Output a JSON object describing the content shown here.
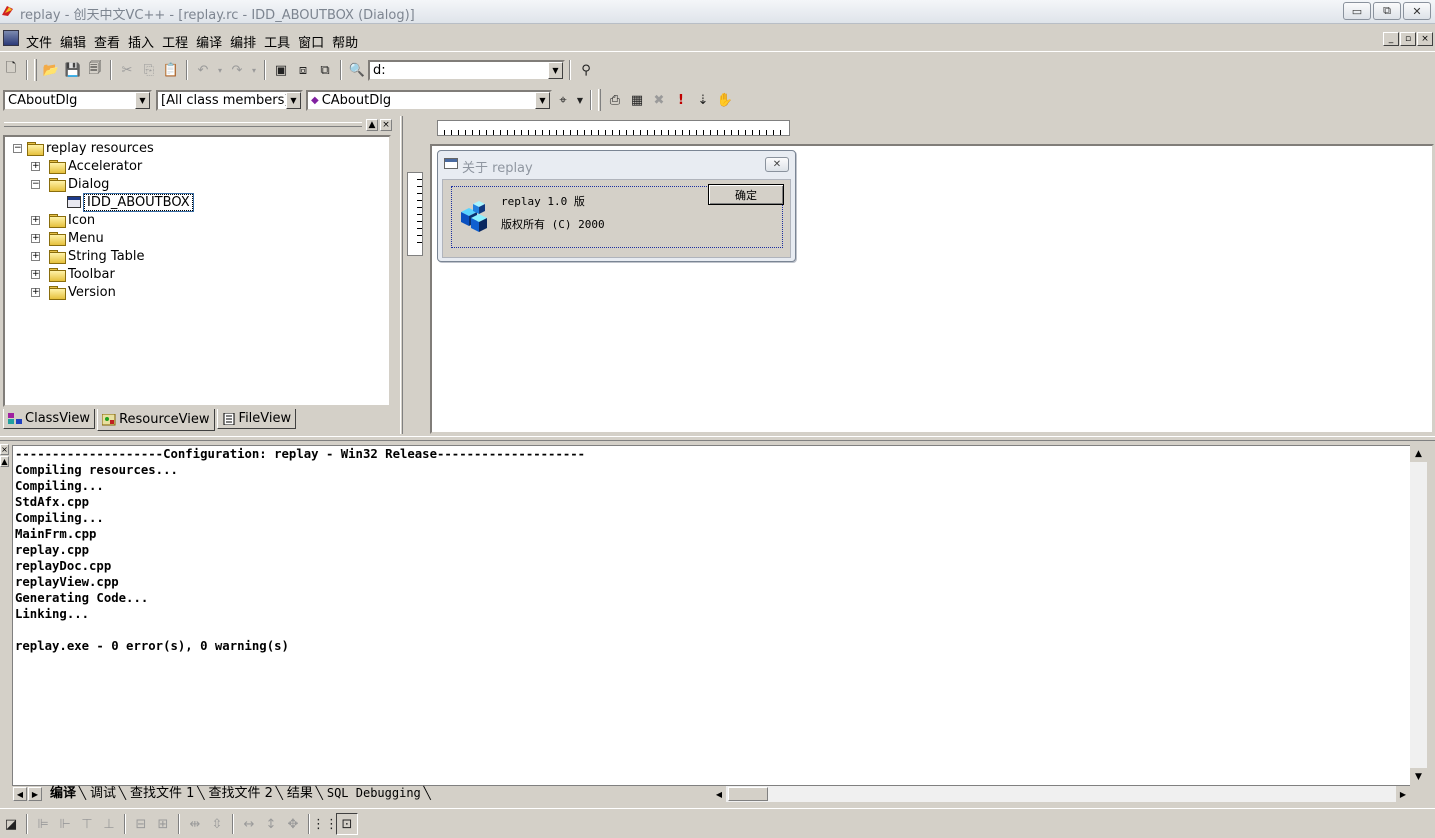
{
  "window": {
    "title": "replay - 创天中文VC++ - [replay.rc - IDD_ABOUTBOX (Dialog)]",
    "buttons": {
      "minimize": "▭",
      "restore": "⧉",
      "close": "✕"
    }
  },
  "menu": {
    "items": [
      "文件",
      "编辑",
      "查看",
      "插入",
      "工程",
      "编译",
      "编排",
      "工具",
      "窗口",
      "帮助"
    ]
  },
  "toolbar": {
    "find_combo_value": "d:",
    "class_combo": "CAboutDlg",
    "filter_combo": "[All class members]",
    "member_combo": "CAboutDlg"
  },
  "workspace": {
    "tree": {
      "root": "replay resources",
      "nodes": [
        {
          "label": "Accelerator"
        },
        {
          "label": "Dialog"
        },
        {
          "label": "IDD_ABOUTBOX"
        },
        {
          "label": "Icon"
        },
        {
          "label": "Menu"
        },
        {
          "label": "String Table"
        },
        {
          "label": "Toolbar"
        },
        {
          "label": "Version"
        }
      ]
    },
    "tabs": [
      "ClassView",
      "ResourceView",
      "FileView"
    ]
  },
  "dialog_preview": {
    "title": "关于 replay",
    "line1": "replay 1.0 版",
    "line2": "版权所有 (C) 2000",
    "ok_button": "确定"
  },
  "output": {
    "lines": [
      "--------------------Configuration: replay - Win32 Release--------------------",
      "Compiling resources...",
      "Compiling...",
      "StdAfx.cpp",
      "Compiling...",
      "MainFrm.cpp",
      "replay.cpp",
      "replayDoc.cpp",
      "replayView.cpp",
      "Generating Code...",
      "Linking...",
      "",
      "replay.exe - 0 error(s), 0 warning(s)"
    ],
    "tabs": [
      "编译",
      "调试",
      "查找文件 1",
      "查找文件 2",
      "结果",
      "SQL Debugging"
    ]
  },
  "colors": {
    "face": "#d4d0c8",
    "selection_outline": "#3a6ea5",
    "dialog_frame": "#1c2fa0"
  }
}
